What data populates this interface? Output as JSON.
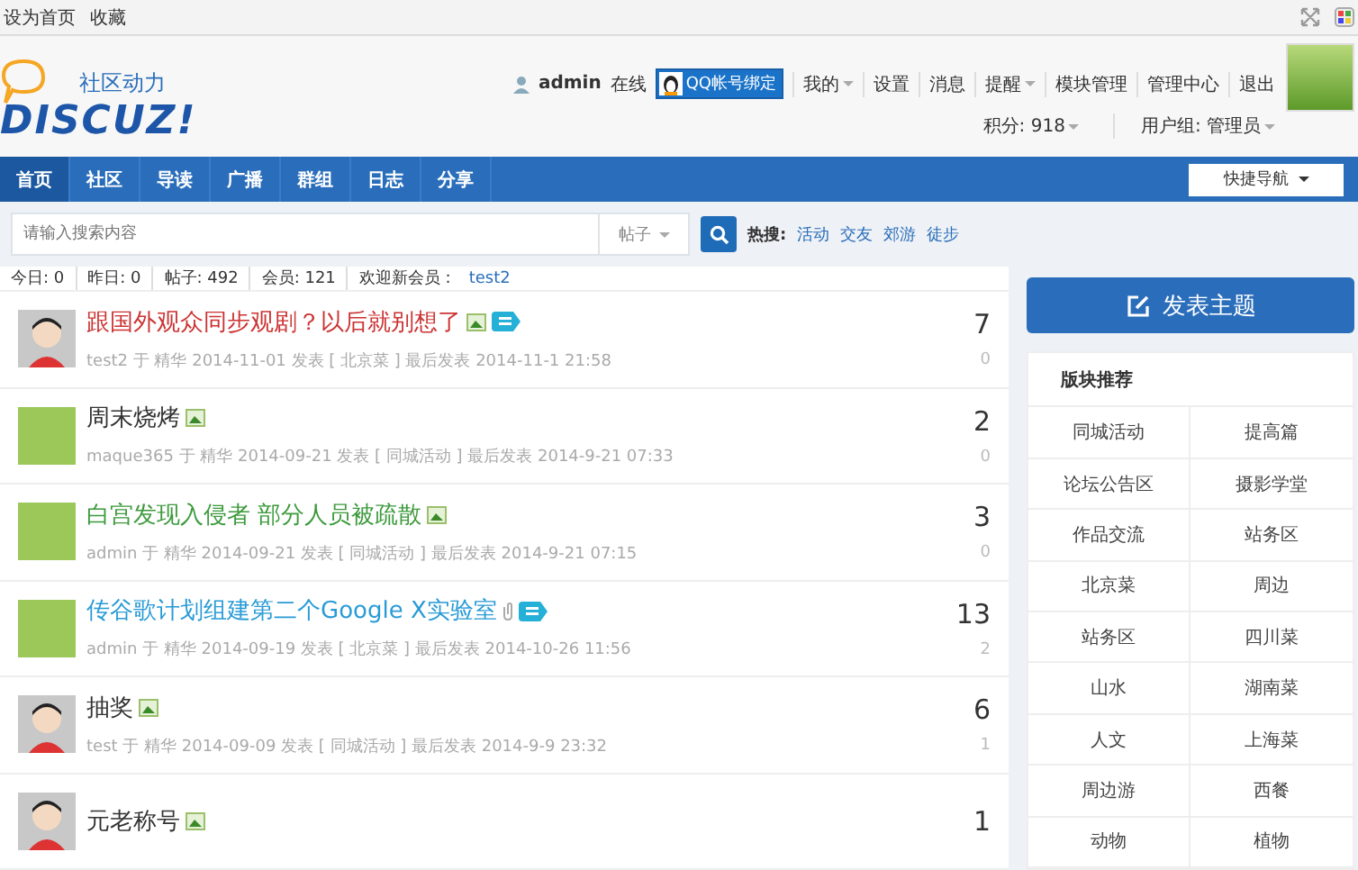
{
  "topbar": {
    "links": [
      "设为首页",
      "收藏"
    ]
  },
  "logo": {
    "tagline": "社区动力",
    "name": "DISCUZ!"
  },
  "user": {
    "name": "admin",
    "status": "在线",
    "qq_button": "QQ帐号绑定",
    "menu": [
      {
        "label": "我的",
        "dropdown": true
      },
      {
        "label": "设置",
        "dropdown": false
      },
      {
        "label": "消息",
        "dropdown": false
      },
      {
        "label": "提醒",
        "dropdown": true
      },
      {
        "label": "模块管理",
        "dropdown": false
      },
      {
        "label": "管理中心",
        "dropdown": false
      },
      {
        "label": "退出",
        "dropdown": false
      }
    ],
    "credits": "积分: 918",
    "group": "用户组: 管理员"
  },
  "nav": {
    "items": [
      {
        "label": "首页",
        "selected": true
      },
      {
        "label": "社区",
        "selected": false
      },
      {
        "label": "导读",
        "selected": false
      },
      {
        "label": "广播",
        "selected": false
      },
      {
        "label": "群组",
        "selected": false
      },
      {
        "label": "日志",
        "selected": false
      },
      {
        "label": "分享",
        "selected": false
      }
    ],
    "quick_nav": "快捷导航"
  },
  "search": {
    "placeholder": "请输入搜索内容",
    "type": "帖子",
    "hot_label": "热搜:",
    "hot": [
      "活动",
      "交友",
      "郊游",
      "徒步"
    ]
  },
  "stats": [
    "今日: 0",
    "昨日: 0",
    "帖子: 492",
    "会员: 121"
  ],
  "welcome": {
    "label": "欢迎新会员 :",
    "member": "test2"
  },
  "threads": [
    {
      "avatar": {
        "kind": "cartoon"
      },
      "title": "跟国外观众同步观剧？以后就别想了",
      "color": "#cc3333",
      "icons": [
        {
          "kind": "image"
        },
        {
          "kind": "digest"
        }
      ],
      "meta": "test2 于 精华 2014-11-01 发表 [ 北京菜 ] 最后发表 2014-11-1 21:58",
      "replies": "7",
      "views": "0"
    },
    {
      "avatar": {
        "kind": "photo"
      },
      "title": "周末烧烤",
      "color": "#333333",
      "icons": [
        {
          "kind": "image"
        }
      ],
      "meta": "maque365 于 精华 2014-09-21 发表 [ 同城活动 ] 最后发表 2014-9-21 07:33",
      "replies": "2",
      "views": "0"
    },
    {
      "avatar": {
        "kind": "photo"
      },
      "title": "白宫发现入侵者 部分人员被疏散",
      "color": "#3c9a3c",
      "icons": [
        {
          "kind": "image"
        }
      ],
      "meta": "admin 于 精华 2014-09-21 发表 [ 同城活动 ] 最后发表 2014-9-21 07:15",
      "replies": "3",
      "views": "0"
    },
    {
      "avatar": {
        "kind": "photo"
      },
      "title": "传谷歌计划组建第二个Google X实验室",
      "color": "#2a9bd6",
      "icons": [
        {
          "kind": "attachment"
        },
        {
          "kind": "digest"
        }
      ],
      "meta": "admin 于 精华 2014-09-19 发表 [ 北京菜 ] 最后发表 2014-10-26 11:56",
      "replies": "13",
      "views": "2"
    },
    {
      "avatar": {
        "kind": "cartoon"
      },
      "title": "抽奖",
      "color": "#333333",
      "icons": [
        {
          "kind": "image"
        }
      ],
      "meta": "test 于 精华 2014-09-09 发表 [ 同城活动 ] 最后发表 2014-9-9 23:32",
      "replies": "6",
      "views": "1"
    },
    {
      "avatar": {
        "kind": "cartoon"
      },
      "title": "元老称号",
      "color": "#333333",
      "icons": [
        {
          "kind": "image"
        }
      ],
      "replies": "1"
    }
  ],
  "sidebar": {
    "post_button": "发表主题",
    "block_title": "版块推荐",
    "forums": [
      "同城活动",
      "提高篇",
      "论坛公告区",
      "摄影学堂",
      "作品交流",
      "站务区",
      "北京菜",
      "周边",
      "站务区",
      "四川菜",
      "山水",
      "湖南菜",
      "人文",
      "上海菜",
      "周边游",
      "西餐",
      "动物",
      "植物"
    ]
  }
}
